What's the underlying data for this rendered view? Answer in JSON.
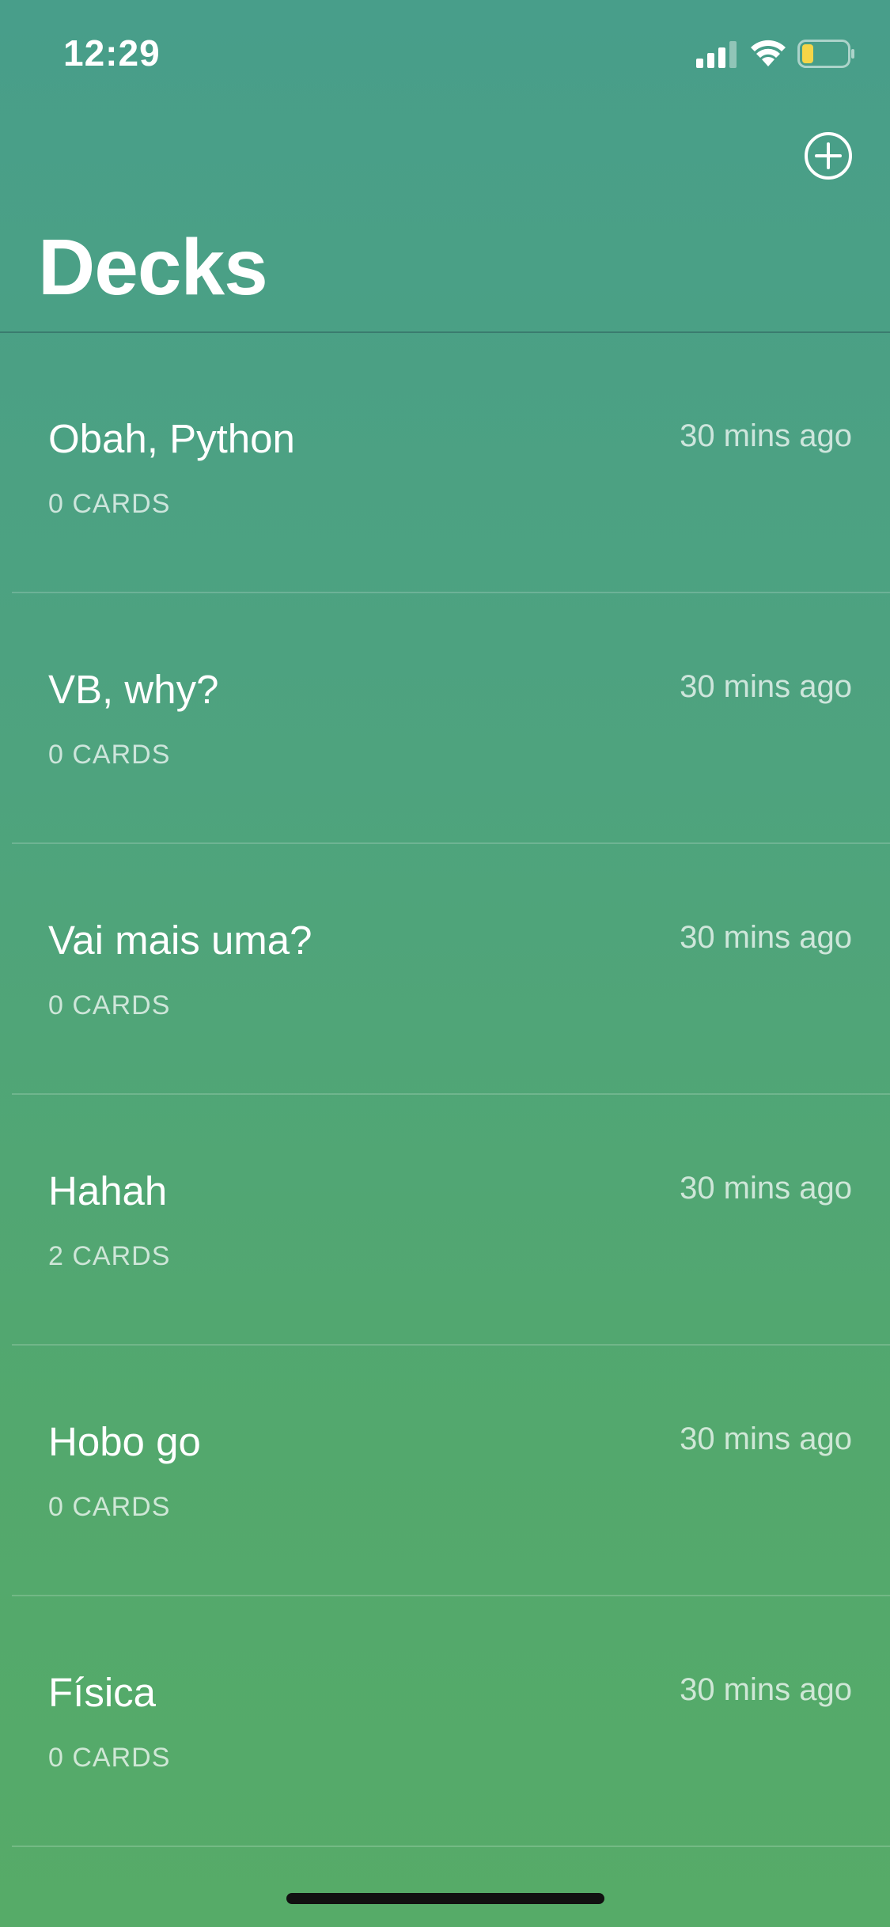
{
  "status_bar": {
    "time": "12:29",
    "battery_level": 0.25,
    "battery_color": "#f5d547"
  },
  "nav": {
    "title": "Decks",
    "add_icon": "plus-circle-icon"
  },
  "decks": [
    {
      "name": "Obah, Python",
      "cards": "0 CARDS",
      "updated": "30 mins ago"
    },
    {
      "name": "VB, why?",
      "cards": "0 CARDS",
      "updated": "30 mins ago"
    },
    {
      "name": "Vai mais uma?",
      "cards": "0 CARDS",
      "updated": "30 mins ago"
    },
    {
      "name": "Hahah",
      "cards": "2 CARDS",
      "updated": "30 mins ago"
    },
    {
      "name": "Hobo go",
      "cards": "0 CARDS",
      "updated": "30 mins ago"
    },
    {
      "name": "Física",
      "cards": "0 CARDS",
      "updated": "30 mins ago"
    }
  ],
  "colors": {
    "background_top": "#489e8a",
    "background_bottom": "#56ab68",
    "text": "#ffffff"
  }
}
